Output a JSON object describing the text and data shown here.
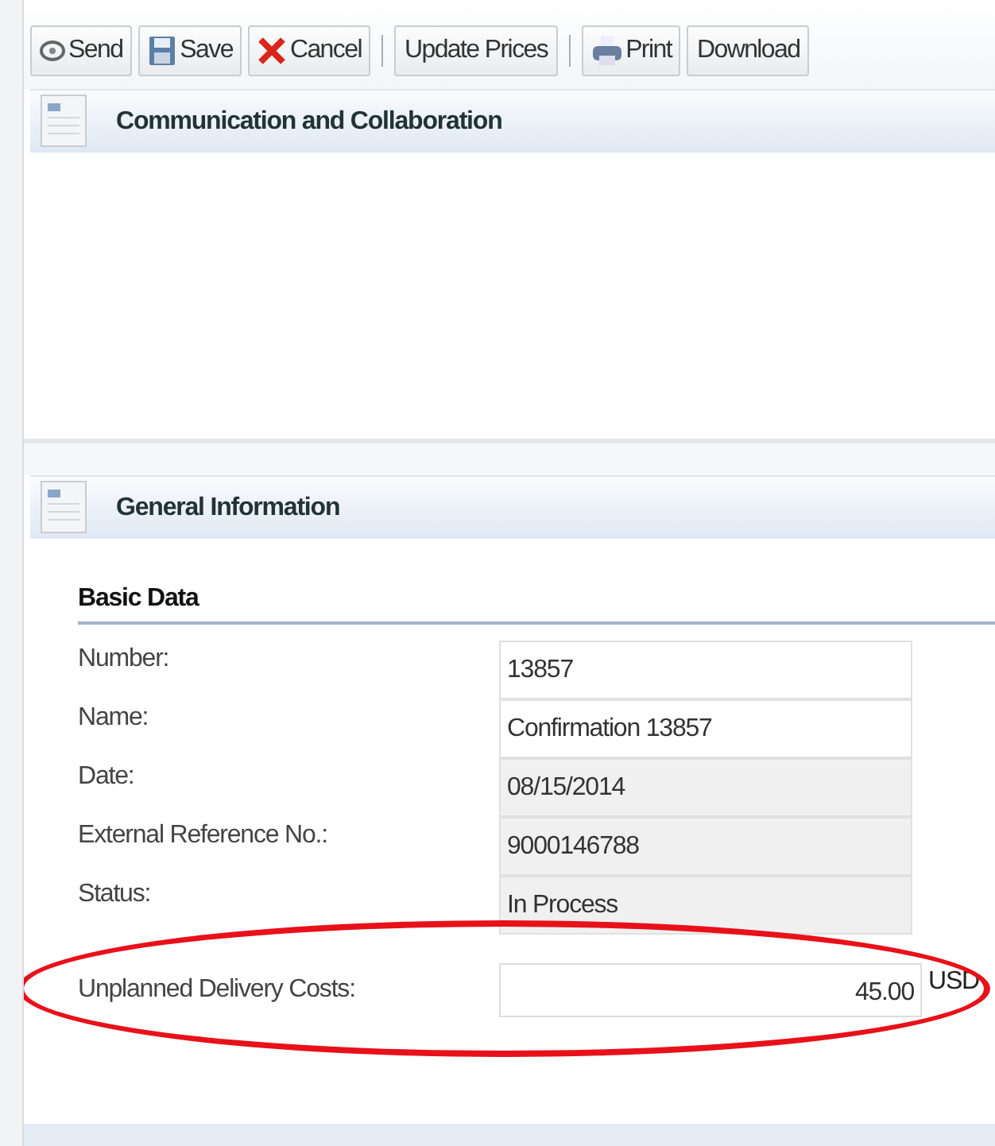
{
  "toolbar": [
    {
      "kind": "send",
      "label": "Send"
    },
    {
      "kind": "save",
      "label": "Save"
    },
    {
      "kind": "cancel",
      "label": "Cancel"
    },
    {
      "kind": "separator"
    },
    {
      "kind": "button",
      "label": "Update Prices"
    },
    {
      "kind": "separator"
    },
    {
      "kind": "print",
      "label": "Print"
    },
    {
      "kind": "button",
      "label": "Download"
    }
  ],
  "panels": [
    {
      "title": "Communication and Collaboration"
    },
    {
      "title": "General Information"
    }
  ],
  "basic_data": {
    "title": "Basic Data",
    "fields": [
      {
        "label": "Number:",
        "value": "13857",
        "readonly": false
      },
      {
        "label": "Name:",
        "value": "Confirmation 13857",
        "readonly": false
      },
      {
        "label": "Date:",
        "value": "08/15/2014",
        "readonly": true
      },
      {
        "label": "External Reference No.:",
        "value": "9000146788",
        "readonly": true
      },
      {
        "label": "Status:",
        "value": "In Process",
        "readonly": true
      }
    ]
  },
  "cost": {
    "label": "Unplanned Delivery Costs:",
    "value": "45.00",
    "unit": "USD",
    "highlighted": true
  }
}
